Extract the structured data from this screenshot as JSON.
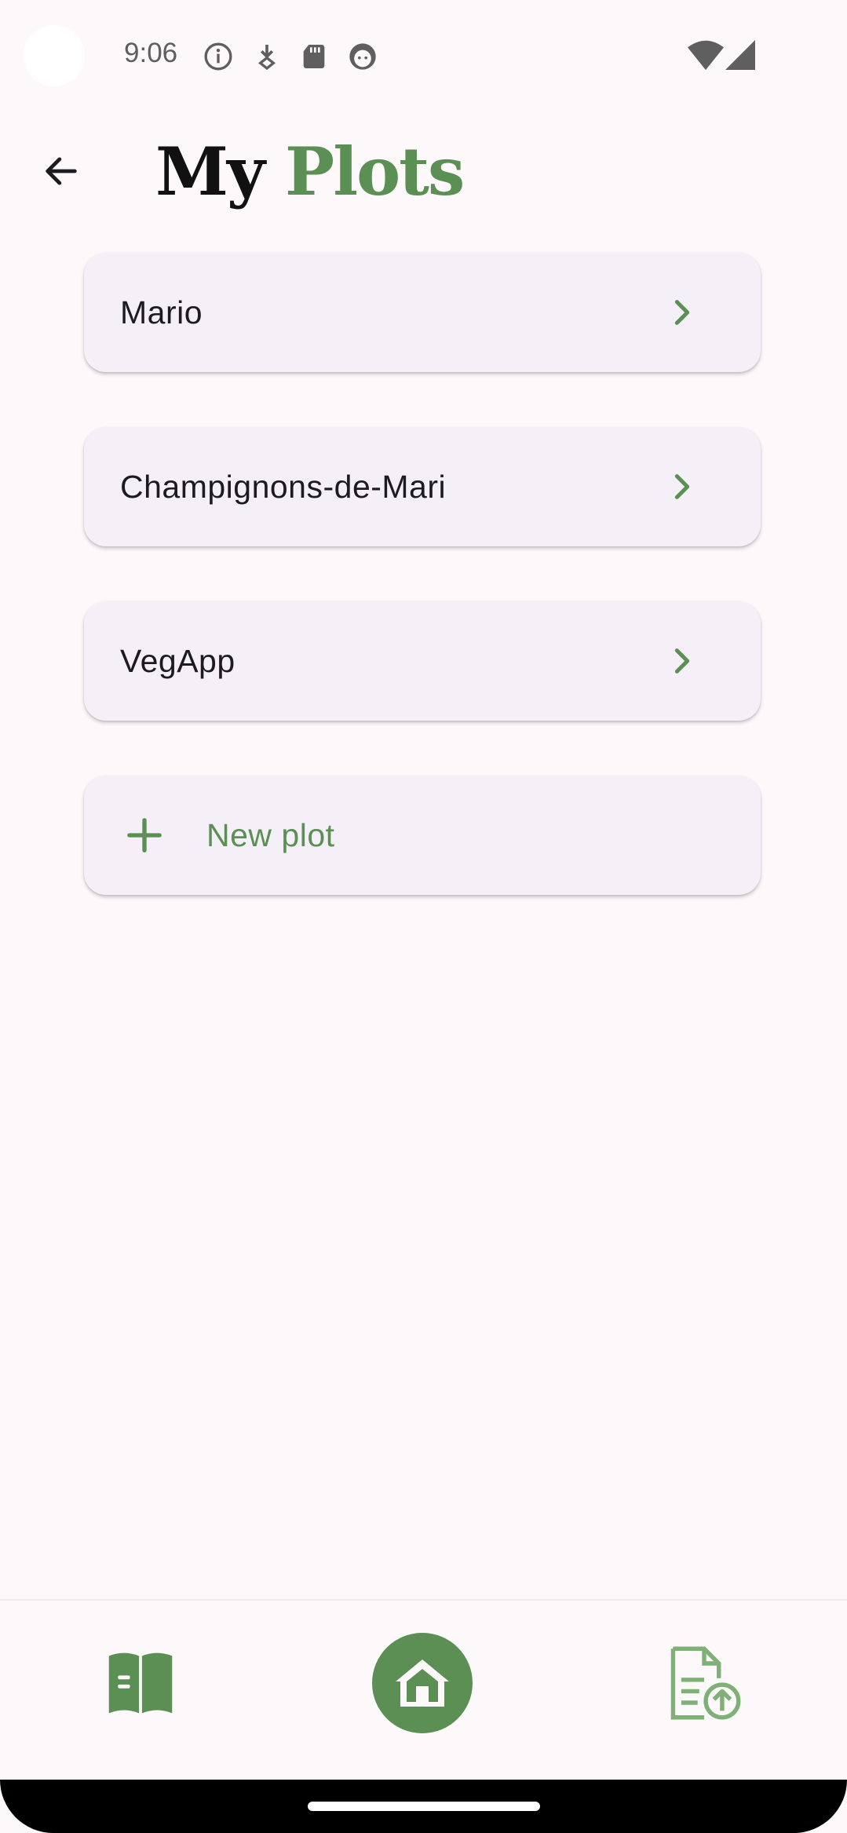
{
  "status_bar": {
    "time": "9:06",
    "icons": [
      "info-icon",
      "download-icon",
      "sd-card-icon",
      "face-icon"
    ],
    "right_icons": [
      "wifi-icon",
      "signal-icon"
    ]
  },
  "header": {
    "back_icon": "arrow-left-icon",
    "title_part1": "My",
    "title_part2": "Plots"
  },
  "plots": [
    {
      "label": "Mario"
    },
    {
      "label": "Champignons-de-Mari"
    },
    {
      "label": "VegApp"
    }
  ],
  "new_plot": {
    "label": "New plot",
    "icon": "plus-icon"
  },
  "bottom_nav": {
    "items": [
      {
        "name": "book",
        "icon": "book-icon"
      },
      {
        "name": "home",
        "icon": "home-icon",
        "active": true
      },
      {
        "name": "upload-document",
        "icon": "document-upload-icon"
      }
    ]
  },
  "colors": {
    "accent": "#5b8f53",
    "background": "#fdf8fa",
    "card": "#f5f0f7",
    "text": "#1c1b1f"
  }
}
